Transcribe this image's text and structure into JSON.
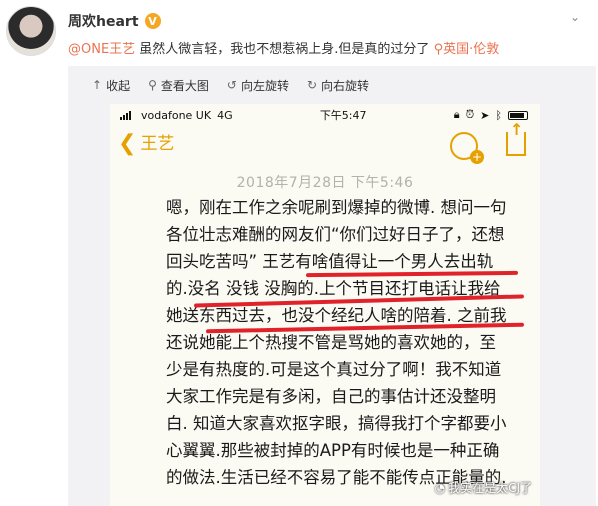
{
  "post": {
    "author": "周欢heart",
    "verified_badge": "V",
    "mention": "@ONE王艺",
    "text": " 虽然人微言轻，我也不想惹祸上身.但是真的过分了 ",
    "location_icon": "pin-icon",
    "location": "英国·伦敦"
  },
  "toolbar": {
    "collapse": "收起",
    "view_large": "查看大图",
    "rotate_left": "向左旋转",
    "rotate_right": "向右旋转"
  },
  "phone": {
    "carrier": "vodafone UK",
    "network": "4G",
    "time": "下午5:47",
    "back_title": "王艺",
    "date": "2018年7月28日  下午5:46",
    "lines": [
      "嗯，刚在工作之余呢刷到爆掉的微博. 想问一句",
      "各位壮志难酬的网友们“你们过好日子了，还想",
      "回头吃苦吗” 王艺有啥值得让一个男人去出轨",
      "的.没名 没钱 没胸的.上个节目还打电话让我给",
      "她送东西过去，也没个经纪人啥的陪着. 之前我",
      "还说她能上个热搜不管是骂她的喜欢她的，至",
      "少是有热度的.可是这个真过分了啊！我不知道",
      "大家工作完是有多闲，自己的事估计还没整明",
      "白. 知道大家喜欢抠字眼，搞得我打个字都要小",
      "心翼翼.那些被封掉的APP有时候也是一种正确",
      "的做法.生活已经不容易了能不能传点正能量的."
    ]
  },
  "watermark": "我实在是太CJ了",
  "colors": {
    "accent": "#eb7350",
    "ios_yellow": "#e6a000",
    "highlight": "#e0232b"
  }
}
